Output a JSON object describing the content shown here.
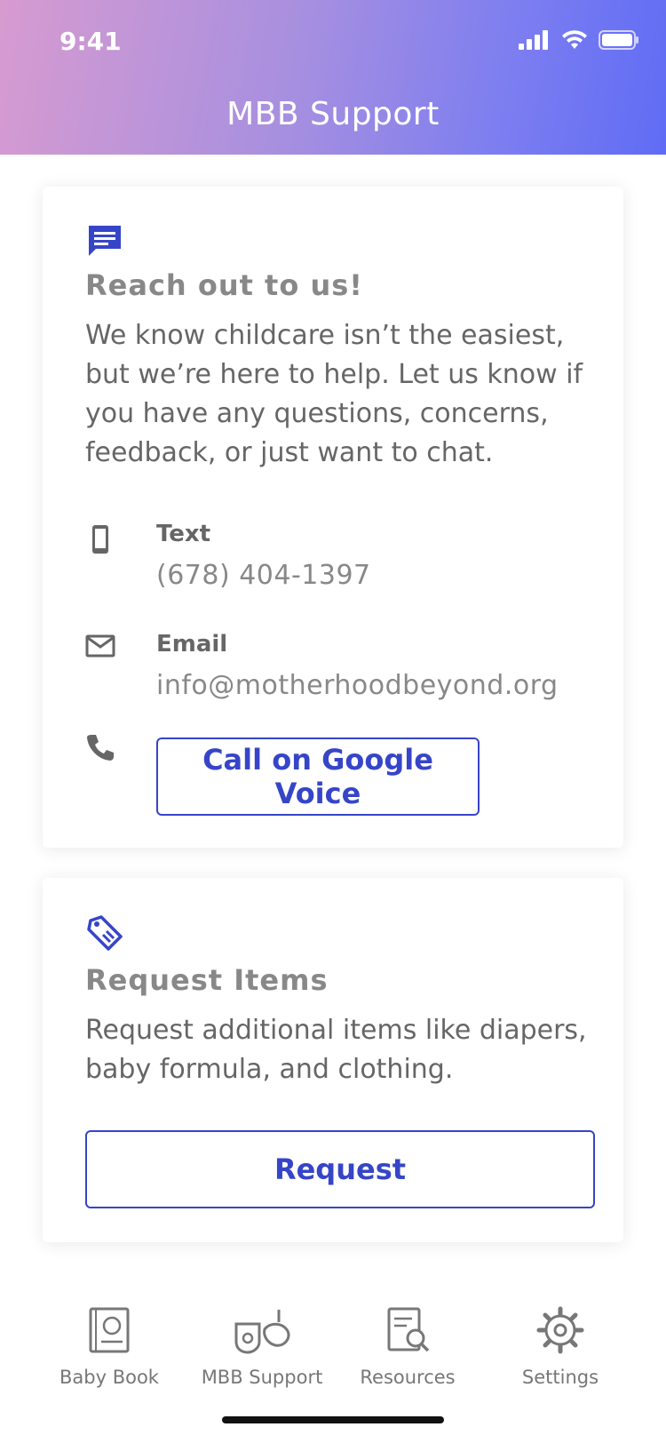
{
  "status_bar": {
    "time": "9:41"
  },
  "header": {
    "title": "MBB Support"
  },
  "contact_card": {
    "title": "Reach out to us!",
    "body": "We know childcare isn’t the easiest, but we’re here to help. Let us know if you have any questions, concerns, feedback, or just want to chat.",
    "text_label": "Text",
    "text_value": "(678) 404-1397",
    "email_label": "Email",
    "email_value": "info@motherhoodbeyond.org",
    "call_button": "Call on Google Voice"
  },
  "request_card": {
    "title": "Request Items",
    "body": "Request additional items like diapers, baby formula, and clothing.",
    "request_button": "Request"
  },
  "tab_bar": {
    "tabs": [
      {
        "label": "Baby Book",
        "icon": "baby-book-icon"
      },
      {
        "label": "MBB Support",
        "icon": "support-icon"
      },
      {
        "label": "Resources",
        "icon": "resources-icon"
      },
      {
        "label": "Settings",
        "icon": "settings-icon"
      }
    ]
  },
  "colors": {
    "accent": "#3645c8",
    "header_start": "#d79bd0",
    "header_end": "#5f6cf5"
  }
}
